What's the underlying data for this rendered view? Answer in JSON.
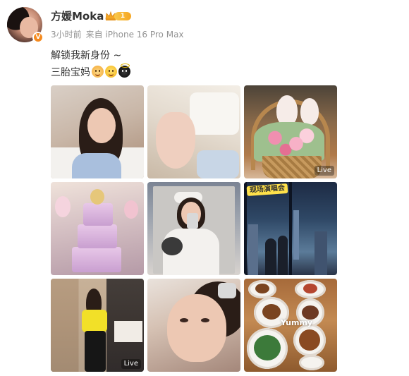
{
  "user": {
    "name": "方媛Moka",
    "level": "1",
    "verified": true,
    "accent_color": "#f58a1f"
  },
  "meta": {
    "time": "3小时前",
    "source": "来自 iPhone 16 Pro Max"
  },
  "content": {
    "line1": "解锁我新身份 ~",
    "line2": "三胎宝妈"
  },
  "emojis": [
    "baby-face-emoji",
    "smile-emoji",
    "angel-emoji"
  ],
  "photos": [
    {
      "name": "photo-selfie-bedroom",
      "badge": ""
    },
    {
      "name": "photo-baby-foot",
      "badge": ""
    },
    {
      "name": "photo-flower-basket-bunnies",
      "badge": "Live"
    },
    {
      "name": "photo-birthday-cake",
      "badge": ""
    },
    {
      "name": "photo-mirror-selfie-with-baby",
      "badge": ""
    },
    {
      "name": "photo-city-night-window",
      "badge": ""
    },
    {
      "name": "photo-yellow-top-mirror-selfie",
      "badge": "Live"
    },
    {
      "name": "photo-closeup-selfie",
      "badge": ""
    },
    {
      "name": "photo-meal-tray",
      "badge": ""
    }
  ],
  "overlays": {
    "photo6_tag": "现场演唱会",
    "photo9_text": "Yummy"
  }
}
